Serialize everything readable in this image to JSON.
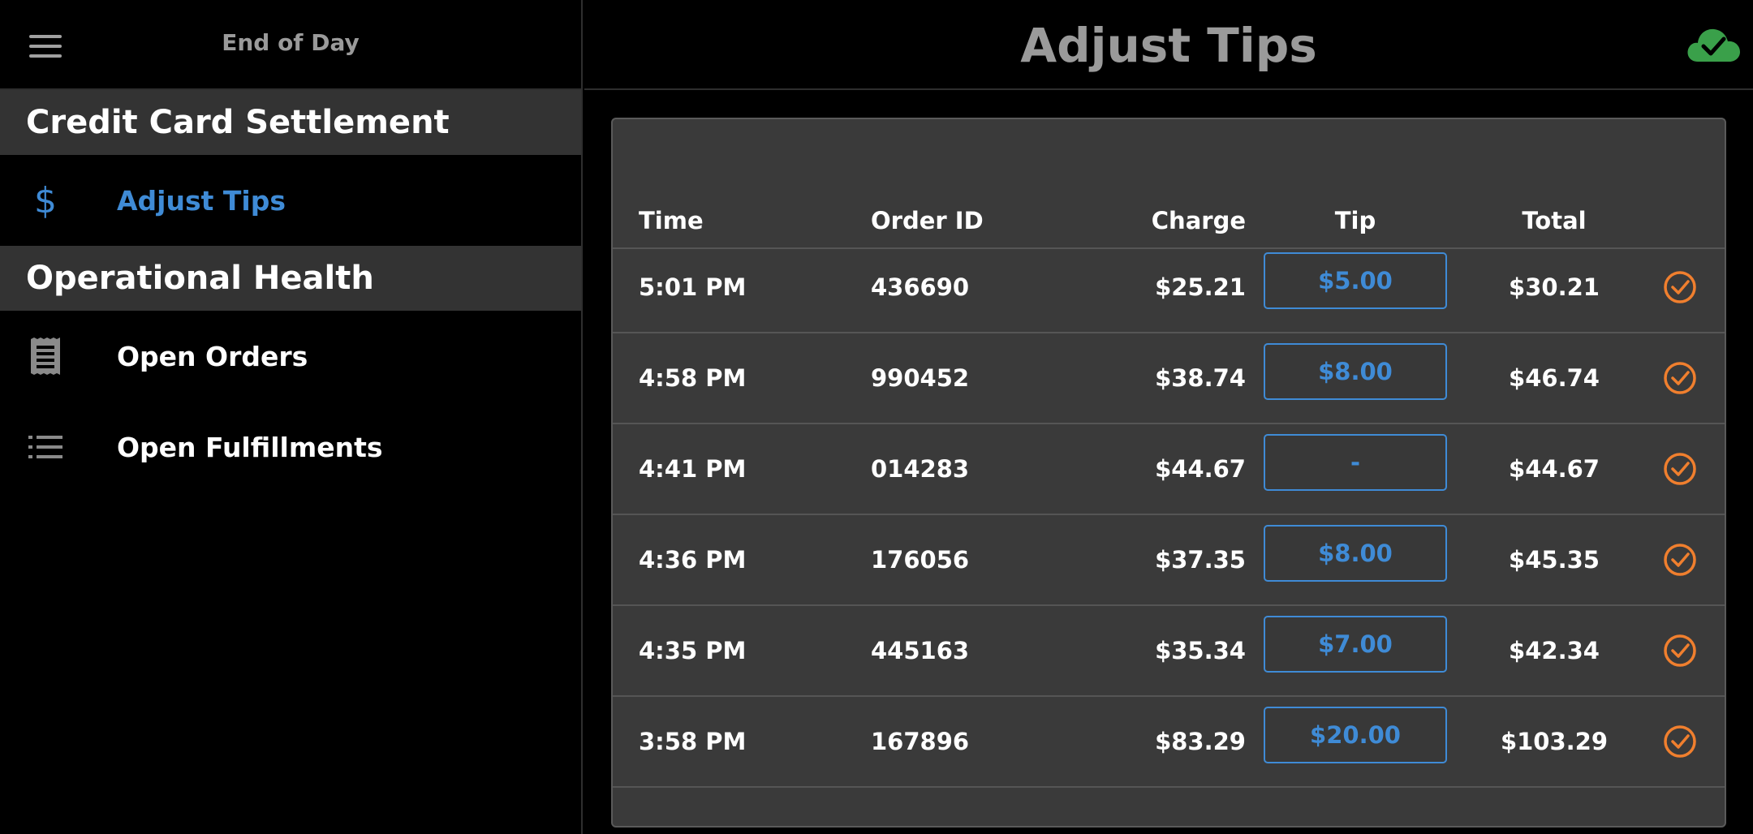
{
  "sidebar": {
    "title": "End of Day",
    "sections": [
      {
        "header": "Credit Card Settlement",
        "items": [
          {
            "label": "Adjust Tips",
            "icon": "dollar-icon",
            "active": true
          }
        ]
      },
      {
        "header": "Operational Health",
        "items": [
          {
            "label": "Open Orders",
            "icon": "receipt-icon"
          },
          {
            "label": "Open Fulfillments",
            "icon": "list-icon"
          }
        ]
      }
    ],
    "dollar_glyph": "$"
  },
  "header": {
    "title": "Adjust Tips",
    "sync_icon": "cloud-check-icon"
  },
  "table": {
    "columns": {
      "time": "Time",
      "order_id": "Order ID",
      "charge": "Charge",
      "tip": "Tip",
      "total": "Total"
    },
    "rows": [
      {
        "time": "5:01 PM",
        "order_id": "436690",
        "charge": "$25.21",
        "tip": "$5.00",
        "total": "$30.21"
      },
      {
        "time": "4:58 PM",
        "order_id": "990452",
        "charge": "$38.74",
        "tip": "$8.00",
        "total": "$46.74"
      },
      {
        "time": "4:41 PM",
        "order_id": "014283",
        "charge": "$44.67",
        "tip": "-",
        "total": "$44.67"
      },
      {
        "time": "4:36 PM",
        "order_id": "176056",
        "charge": "$37.35",
        "tip": "$8.00",
        "total": "$45.35"
      },
      {
        "time": "4:35 PM",
        "order_id": "445163",
        "charge": "$35.34",
        "tip": "$7.00",
        "total": "$42.34"
      },
      {
        "time": "3:58 PM",
        "order_id": "167896",
        "charge": "$83.29",
        "tip": "$20.00",
        "total": "$103.29"
      }
    ]
  },
  "colors": {
    "accent_blue": "#3f8bd6",
    "check_orange": "#f07f2e",
    "cloud_green": "#3aa04a",
    "panel_bg": "#3a3a3a",
    "section_bg": "#333333"
  }
}
